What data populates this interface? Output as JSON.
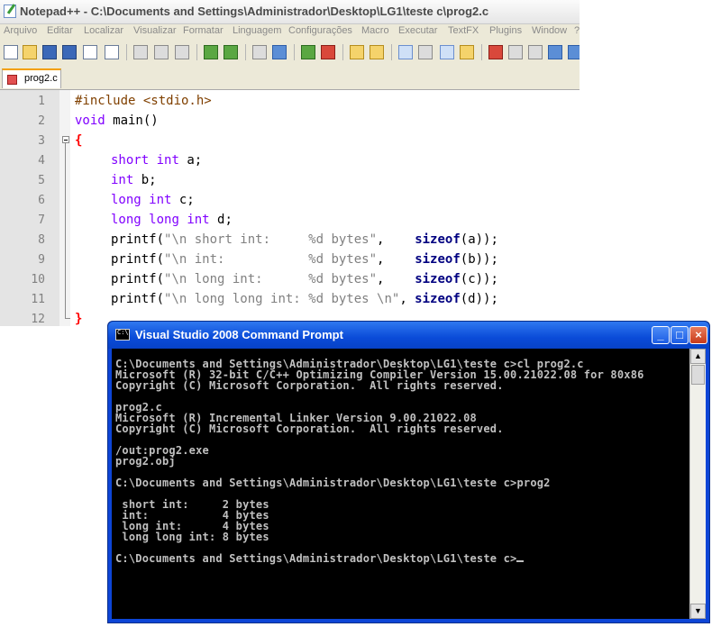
{
  "notepad": {
    "title": "Notepad++ - C:\\Documents and Settings\\Administrador\\Desktop\\LG1\\teste c\\prog2.c",
    "menu": [
      "Arquivo",
      "Editar",
      "Localizar",
      "Visualizar",
      "Formatar",
      "Linguagem",
      "Configurações",
      "Macro",
      "Executar",
      "TextFX",
      "Plugins",
      "Window",
      "?"
    ],
    "toolbar_icons": [
      "new-file-icon",
      "open-folder-icon",
      "save-icon",
      "save-all-icon",
      "close-icon",
      "close-all-icon",
      "cut-icon",
      "copy-icon",
      "paste-icon",
      "undo-icon",
      "redo-icon",
      "find-icon",
      "replace-icon",
      "zoom-in-icon",
      "zoom-out-icon",
      "sync-v-icon",
      "sync-h-icon",
      "wrap-icon",
      "show-all-chars-icon",
      "indent-guide-icon",
      "user-lang-icon",
      "record-macro-icon",
      "stop-macro-icon",
      "play-macro-icon",
      "run-macro-multiple-icon",
      "save-macro-icon"
    ],
    "tab": {
      "label": "prog2.c"
    },
    "line_numbers": [
      "1",
      "2",
      "3",
      "4",
      "5",
      "6",
      "7",
      "8",
      "9",
      "10",
      "11",
      "12"
    ],
    "code": {
      "l1": "#include <stdio.h>",
      "l2a": "void",
      "l2b": " main()",
      "l3": "{",
      "l4a": "short",
      "l4b": " ",
      "l4c": "int",
      "l4d": " a;",
      "l5a": "int",
      "l5b": " b;",
      "l6a": "long",
      "l6b": " ",
      "l6c": "int",
      "l6d": " c;",
      "l7a": "long",
      "l7b": " ",
      "l7c": "long",
      "l7d": " ",
      "l7e": "int",
      "l7f": " d;",
      "l8a": "printf(",
      "l8b": "\"\\n short int:     %d bytes\"",
      "l8c": ",    ",
      "l8d": "sizeof",
      "l8e": "(a));",
      "l9a": "printf(",
      "l9b": "\"\\n int:           %d bytes\"",
      "l9c": ",    ",
      "l9d": "sizeof",
      "l9e": "(b));",
      "l10a": "printf(",
      "l10b": "\"\\n long int:      %d bytes\"",
      "l10c": ",    ",
      "l10d": "sizeof",
      "l10e": "(c));",
      "l11a": "printf(",
      "l11b": "\"\\n long long int: %d bytes \\n\"",
      "l11c": ", ",
      "l11d": "sizeof",
      "l11e": "(d));",
      "l12": "}"
    }
  },
  "console": {
    "title": "Visual Studio 2008 Command Prompt",
    "buttons": {
      "minimize": "_",
      "maximize": "□",
      "close": "×"
    },
    "lines": [
      "C:\\Documents and Settings\\Administrador\\Desktop\\LG1\\teste c>cl prog2.c",
      "Microsoft (R) 32-bit C/C++ Optimizing Compiler Version 15.00.21022.08 for 80x86",
      "Copyright (C) Microsoft Corporation.  All rights reserved.",
      "",
      "prog2.c",
      "Microsoft (R) Incremental Linker Version 9.00.21022.08",
      "Copyright (C) Microsoft Corporation.  All rights reserved.",
      "",
      "/out:prog2.exe",
      "prog2.obj",
      "",
      "C:\\Documents and Settings\\Administrador\\Desktop\\LG1\\teste c>prog2",
      "",
      " short int:     2 bytes",
      " int:           4 bytes",
      " long int:      4 bytes",
      " long long int: 8 bytes",
      "",
      "C:\\Documents and Settings\\Administrador\\Desktop\\LG1\\teste c>"
    ]
  }
}
